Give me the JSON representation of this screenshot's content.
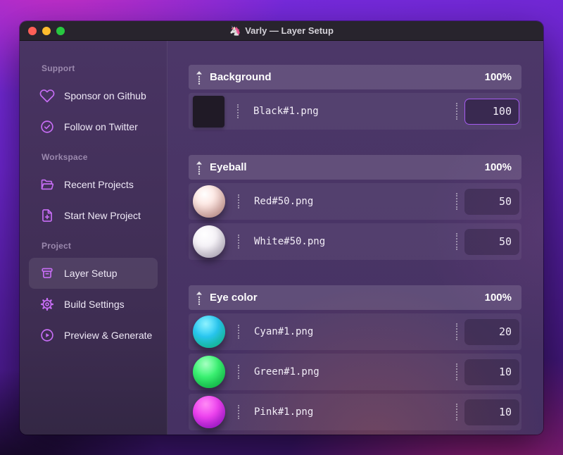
{
  "window": {
    "title": "Varly — Layer Setup",
    "app_icon": "🦄"
  },
  "titlebar": {
    "traffic_lights": [
      "close",
      "minimize",
      "zoom"
    ]
  },
  "sidebar": {
    "sections": [
      {
        "label": "Support",
        "items": [
          {
            "icon": "heart-icon",
            "label": "Sponsor on Github"
          },
          {
            "icon": "verified-badge-icon",
            "label": "Follow on Twitter"
          }
        ]
      },
      {
        "label": "Workspace",
        "items": [
          {
            "icon": "folder-open-icon",
            "label": "Recent Projects"
          },
          {
            "icon": "file-plus-icon",
            "label": "Start New Project"
          }
        ]
      },
      {
        "label": "Project",
        "items": [
          {
            "icon": "layer-box-icon",
            "label": "Layer Setup",
            "selected": true
          },
          {
            "icon": "gear-icon",
            "label": "Build Settings"
          },
          {
            "icon": "play-circle-icon",
            "label": "Preview & Generate"
          }
        ]
      }
    ]
  },
  "layers": {
    "groups": [
      {
        "name": "Background",
        "weight": "100%",
        "items": [
          {
            "file": "Black#1.png",
            "value": "100",
            "thumb": "black-square",
            "focused": true
          }
        ]
      },
      {
        "name": "Eyeball",
        "weight": "100%",
        "items": [
          {
            "file": "Red#50.png",
            "value": "50",
            "thumb": "red-sphere"
          },
          {
            "file": "White#50.png",
            "value": "50",
            "thumb": "white-sphere"
          }
        ]
      },
      {
        "name": "Eye color",
        "weight": "100%",
        "items": [
          {
            "file": "Cyan#1.png",
            "value": "20",
            "thumb": "cyan-sphere"
          },
          {
            "file": "Green#1.png",
            "value": "10",
            "thumb": "green-sphere"
          },
          {
            "file": "Pink#1.png",
            "value": "10",
            "thumb": "pink-sphere"
          }
        ]
      }
    ]
  },
  "colors": {
    "accent": "#a55bf0",
    "sidebar_icon": "#c76df5",
    "titlebar_bg": "#28242d",
    "sidebar_bg": "#423058",
    "content_bg": "#4c3768",
    "group_header_bg": "#6b5489",
    "traffic_red": "#ff5f57",
    "traffic_yellow": "#febc2e",
    "traffic_green": "#28c840"
  }
}
